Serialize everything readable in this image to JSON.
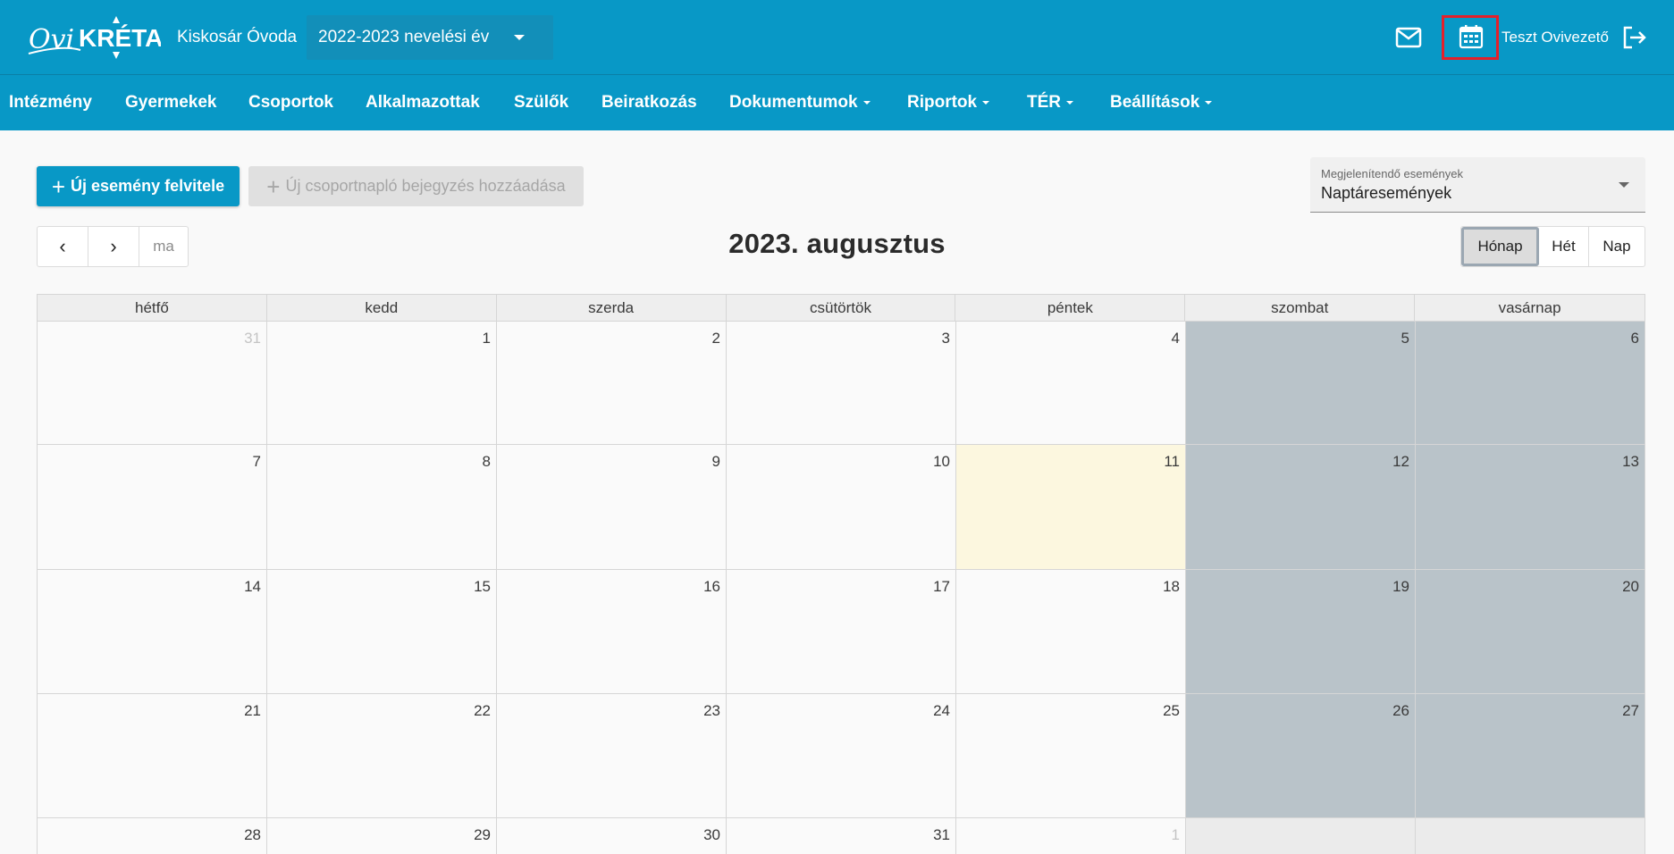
{
  "header": {
    "logo_text": "Ovi KRÉTA",
    "school_name": "Kiskosár Óvoda",
    "school_year": "2022-2023 nevelési év",
    "user_name": "Teszt Ovivezető",
    "icons": [
      "mail-icon",
      "calendar-icon",
      "logout-icon"
    ],
    "highlight_color": "#e5202a",
    "brand_color": "#0898c6"
  },
  "nav": {
    "items": [
      {
        "label": "Intézmény",
        "dropdown": false
      },
      {
        "label": "Gyermekek",
        "dropdown": false
      },
      {
        "label": "Csoportok",
        "dropdown": false
      },
      {
        "label": "Alkalmazottak",
        "dropdown": false
      },
      {
        "label": "Szülők",
        "dropdown": false
      },
      {
        "label": "Beiratkozás",
        "dropdown": false
      },
      {
        "label": "Dokumentumok",
        "dropdown": true
      },
      {
        "label": "Riportok",
        "dropdown": true
      },
      {
        "label": "TÉR",
        "dropdown": true
      },
      {
        "label": "Beállítások",
        "dropdown": true
      }
    ]
  },
  "toolbar": {
    "new_event_label": "Új esemény felvitele",
    "new_journal_label": "Új csoportnapló bejegyzés hozzáadása",
    "filter_label": "Megjelenítendő események",
    "filter_value": "Naptáresemények",
    "today_label": "ma",
    "prev_symbol": "‹",
    "next_symbol": "›",
    "view_month": "Hónap",
    "view_week": "Hét",
    "view_day": "Nap"
  },
  "calendar": {
    "title": "2023. augusztus",
    "weekdays": [
      "hétfő",
      "kedd",
      "szerda",
      "csütörtök",
      "péntek",
      "szombat",
      "vasárnap"
    ],
    "weeks": [
      [
        {
          "d": "31",
          "other": true
        },
        {
          "d": "1"
        },
        {
          "d": "2"
        },
        {
          "d": "3"
        },
        {
          "d": "4"
        },
        {
          "d": "5"
        },
        {
          "d": "6"
        }
      ],
      [
        {
          "d": "7"
        },
        {
          "d": "8"
        },
        {
          "d": "9"
        },
        {
          "d": "10"
        },
        {
          "d": "11",
          "today": true
        },
        {
          "d": "12"
        },
        {
          "d": "13"
        }
      ],
      [
        {
          "d": "14"
        },
        {
          "d": "15"
        },
        {
          "d": "16"
        },
        {
          "d": "17"
        },
        {
          "d": "18"
        },
        {
          "d": "19"
        },
        {
          "d": "20"
        }
      ],
      [
        {
          "d": "21"
        },
        {
          "d": "22"
        },
        {
          "d": "23"
        },
        {
          "d": "24"
        },
        {
          "d": "25"
        },
        {
          "d": "26"
        },
        {
          "d": "27"
        }
      ],
      [
        {
          "d": "28"
        },
        {
          "d": "29"
        },
        {
          "d": "30"
        },
        {
          "d": "31"
        },
        {
          "d": "1",
          "other": true
        },
        {
          "d": ""
        },
        {
          "d": ""
        }
      ]
    ]
  }
}
